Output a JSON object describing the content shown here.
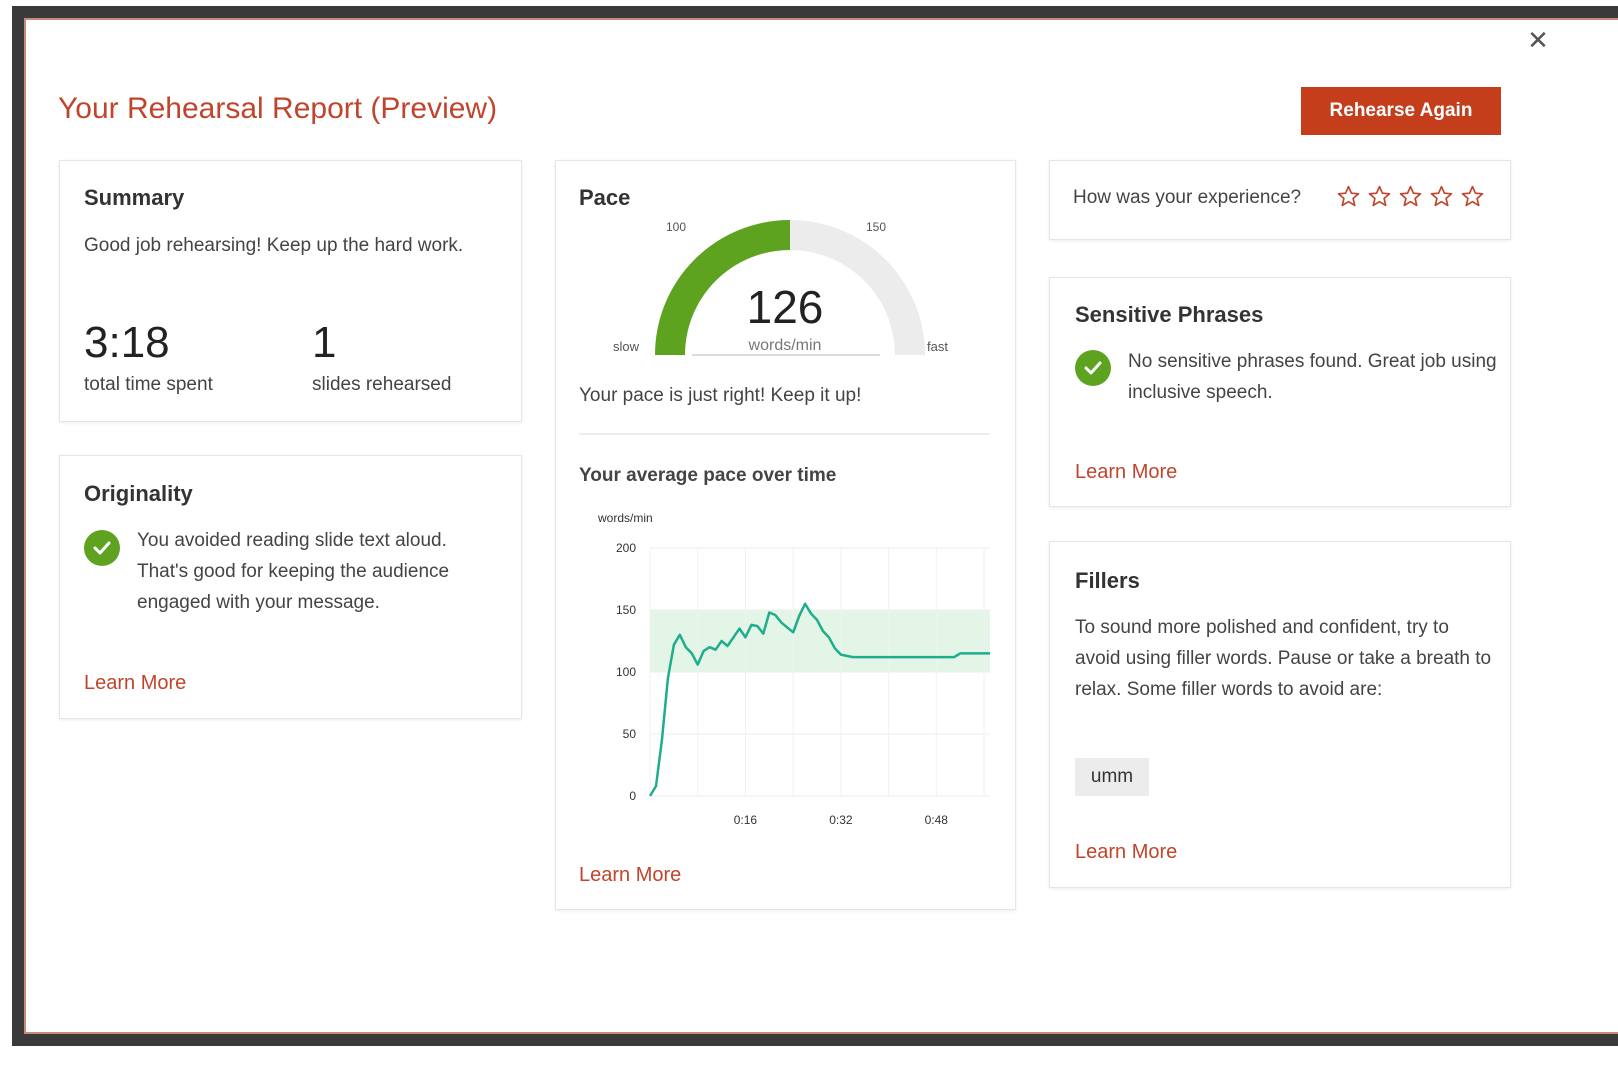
{
  "dialog": {
    "title": "Your Rehearsal Report (Preview)",
    "rehearse_again_label": "Rehearse Again",
    "close_icon": "close-icon"
  },
  "summary": {
    "heading": "Summary",
    "text": "Good job rehearsing! Keep up the hard work.",
    "total_time": "3:18",
    "total_time_label": "total time spent",
    "slides": "1",
    "slides_label": "slides rehearsed"
  },
  "originality": {
    "heading": "Originality",
    "text": "You avoided reading slide text aloud. That's good for keeping the audience engaged with your message.",
    "learn_more": "Learn More"
  },
  "pace": {
    "heading": "Pace",
    "gauge": {
      "value": 126,
      "unit": "words/min",
      "tick_low": "100",
      "tick_high": "150",
      "label_slow": "slow",
      "label_fast": "fast",
      "scale_min": 50,
      "scale_max": 200,
      "fill_color": "#5ea31f",
      "track_color": "#ececec"
    },
    "message": "Your pace is just right! Keep it up!",
    "chart_title": "Your average pace over time",
    "learn_more": "Learn More"
  },
  "chart_data": {
    "type": "line",
    "title": "Your average pace over time",
    "ylabel": "words/min",
    "xlabel": "",
    "ylim": [
      0,
      200
    ],
    "yticks": [
      "200",
      "150",
      "100",
      "50",
      "0"
    ],
    "xticks": [
      "0:16",
      "0:32",
      "0:48"
    ],
    "xlim": [
      0,
      57
    ],
    "band": {
      "from": 100,
      "to": 150,
      "color": "#e3f5e6"
    },
    "line_color": "#1fad8c",
    "grid": true,
    "series": [
      {
        "x": [
          0,
          1,
          2,
          3,
          4,
          5,
          6,
          7,
          8,
          9,
          10,
          11,
          12,
          13,
          14,
          15,
          16,
          17,
          18,
          19,
          20,
          21,
          22,
          23,
          24,
          25,
          26,
          27,
          28,
          29,
          30,
          31,
          32,
          33,
          34,
          35,
          36,
          37,
          38,
          39,
          40,
          41,
          42,
          43,
          44,
          45,
          46,
          47,
          48,
          49,
          50,
          51,
          52,
          53,
          54,
          55,
          56,
          57
        ],
        "y": [
          0,
          8,
          45,
          95,
          122,
          130,
          120,
          115,
          106,
          117,
          120,
          118,
          125,
          121,
          128,
          135,
          128,
          138,
          137,
          131,
          148,
          146,
          140,
          136,
          132,
          145,
          155,
          147,
          142,
          133,
          128,
          119,
          114,
          113,
          112,
          112,
          112,
          112,
          112,
          112,
          112,
          112,
          112,
          112,
          112,
          112,
          112,
          112,
          112,
          112,
          112,
          112,
          115,
          115,
          115,
          115,
          115,
          115
        ]
      }
    ]
  },
  "experience": {
    "question": "How was your experience?",
    "stars": 5,
    "star_icon": "star-outline-icon",
    "star_color": "#c0452c"
  },
  "sensitive": {
    "heading": "Sensitive Phrases",
    "text": "No sensitive phrases found. Great job using inclusive speech.",
    "learn_more": "Learn More"
  },
  "fillers": {
    "heading": "Fillers",
    "text": "To sound more polished and confident, try to avoid using filler words. Pause or take a breath to relax. Some filler words to avoid are:",
    "chip": "umm",
    "learn_more": "Learn More"
  }
}
